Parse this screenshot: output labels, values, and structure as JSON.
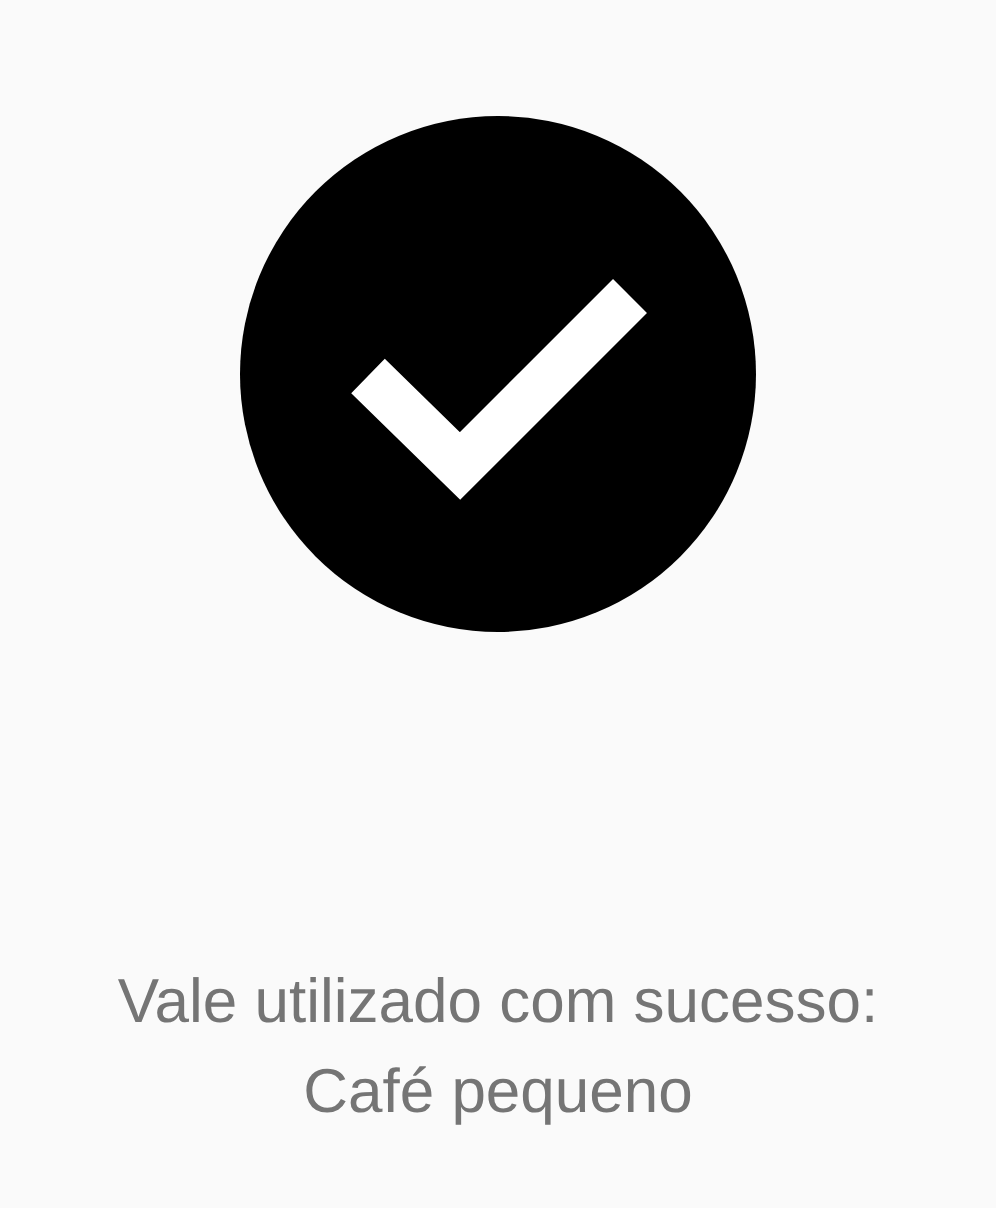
{
  "status": {
    "kind": "success"
  },
  "message": "Vale utilizado com sucesso:",
  "item_name": "Café pequeno"
}
